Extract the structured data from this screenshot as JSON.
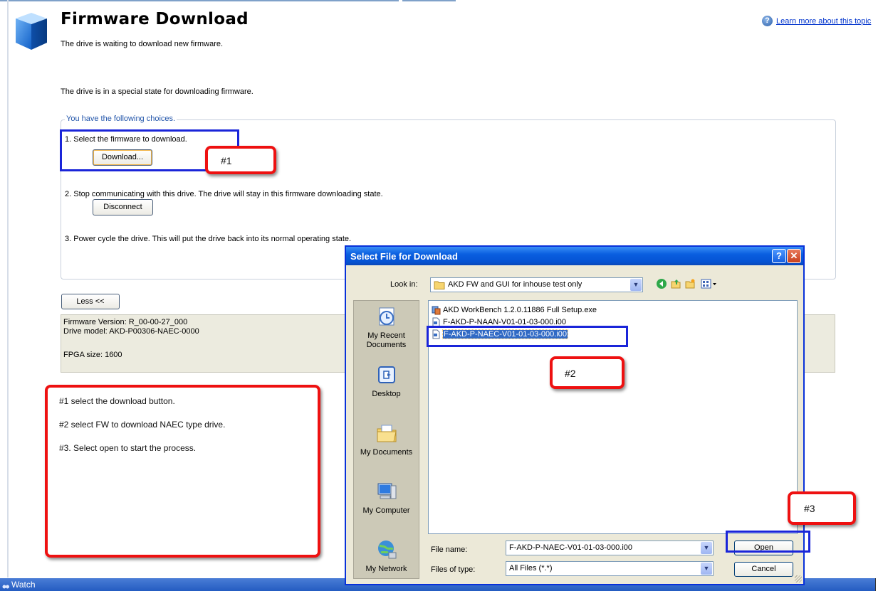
{
  "page": {
    "title": "Firmware Download",
    "subtitle": "The drive is waiting to download new firmware.",
    "help_link": "Learn more about this topic",
    "state_text": "The drive is in a special state for downloading firmware.",
    "choices_legend": "You have the following choices.",
    "choice1": "1. Select the firmware to download.",
    "download_button": "Download...",
    "choice2": "2. Stop communicating with this drive.  The drive will stay in this firmware downloading state.",
    "disconnect_button": "Disconnect",
    "choice3": "3. Power cycle the drive.  This will put the drive back into its normal operating state.",
    "less_button": "Less <<",
    "info": {
      "firmware_version": "Firmware Version: R_00-00-27_000",
      "drive_model": "Drive model: AKD-P00306-NAEC-0000",
      "fpga_size": "FPGA size: 1600"
    }
  },
  "annotations": {
    "label1": "#1",
    "label2": "#2",
    "label3": "#3",
    "notes": [
      "#1  select the download button.",
      "#2 select FW to download  NAEC type drive.",
      "#3. Select open to start the process."
    ]
  },
  "dialog": {
    "title": "Select File for Download",
    "help_glyph": "?",
    "close_glyph": "✕",
    "look_in_label": "Look in:",
    "look_in_value": "AKD FW and GUI for inhouse test only",
    "places": [
      "My Recent Documents",
      "Desktop",
      "My Documents",
      "My Computer",
      "My Network"
    ],
    "files": [
      {
        "name": "AKD WorkBench 1.2.0.11886 Full Setup.exe",
        "icon": "setup-exe-icon"
      },
      {
        "name": "F-AKD-P-NAAN-V01-01-03-000.i00",
        "icon": "file-icon"
      },
      {
        "name": "F-AKD-P-NAEC-V01-01-03-000.i00",
        "icon": "file-icon",
        "selected": true
      }
    ],
    "file_name_label": "File name:",
    "file_name_value": "F-AKD-P-NAEC-V01-01-03-000.i00",
    "file_type_label": "Files of type:",
    "file_type_value": "All Files (*.*)",
    "open_button": "Open",
    "cancel_button": "Cancel"
  },
  "statusbar": {
    "watch_label": "Watch"
  },
  "colors": {
    "annotation_red": "#ee1111",
    "annotation_blue": "#1a25d9",
    "selection": "#316ac5",
    "titlebar": "#0a5fe0"
  }
}
